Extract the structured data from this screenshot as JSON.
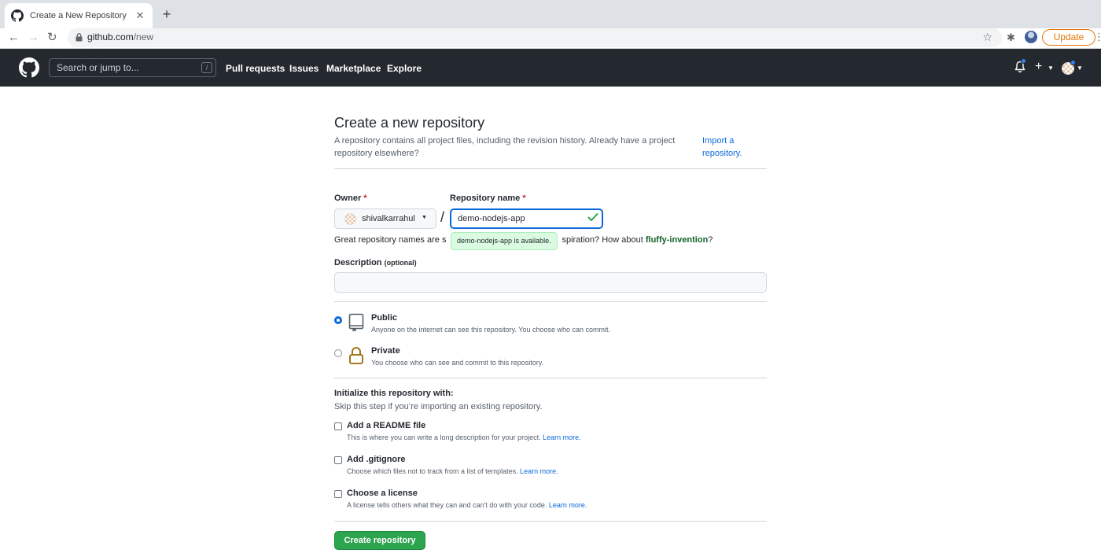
{
  "browser": {
    "tab_title": "Create a New Repository",
    "url_host": "github.com",
    "url_path": "/new",
    "update_label": "Update"
  },
  "header": {
    "search_placeholder": "Search or jump to...",
    "search_shortcut": "/",
    "nav": [
      "Pull requests",
      "Issues",
      "Marketplace",
      "Explore"
    ]
  },
  "page": {
    "title": "Create a new repository",
    "lead": "A repository contains all project files, including the revision history. Already have a project repository elsewhere?",
    "import_link": "Import a repository.",
    "owner_label": "Owner",
    "repo_label": "Repository name",
    "required_mark": "*",
    "owner_value": "shivalkarrahul",
    "separator": "/",
    "repo_value": "demo-nodejs-app",
    "availability": "demo-nodejs-app is available.",
    "hint_prefix": "Great repository names are s",
    "hint_mid": "spiration? How about ",
    "hint_suggestion": "fluffy-invention",
    "hint_end": "?",
    "description_label": "Description",
    "description_optional": "(optional)",
    "description_value": ""
  },
  "visibility": {
    "public_title": "Public",
    "public_desc": "Anyone on the internet can see this repository. You choose who can commit.",
    "private_title": "Private",
    "private_desc": "You choose who can see and commit to this repository.",
    "selected": "Public"
  },
  "init": {
    "heading": "Initialize this repository with:",
    "subheading": "Skip this step if you’re importing an existing repository.",
    "learn_more": "Learn more.",
    "options": [
      {
        "title": "Add a README file",
        "desc": "This is where you can write a long description for your project.",
        "checked": false
      },
      {
        "title": "Add .gitignore",
        "desc": "Choose which files not to track from a list of templates.",
        "checked": false
      },
      {
        "title": "Choose a license",
        "desc": "A license tells others what they can and can't do with your code.",
        "checked": false
      }
    ]
  },
  "actions": {
    "create_label": "Create repository"
  },
  "colors": {
    "header_bg": "#24292f",
    "primary_button": "#2da44e",
    "link": "#0969da",
    "success_tooltip": "#dafbe1"
  }
}
